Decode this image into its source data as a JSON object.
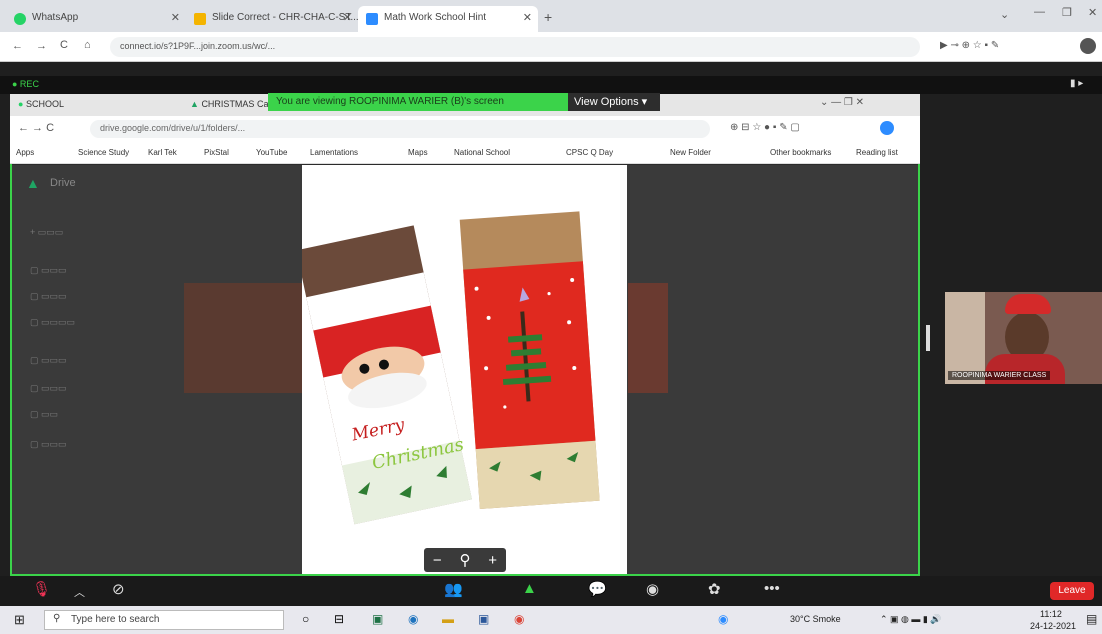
{
  "outer_browser": {
    "tabs": [
      {
        "label": "WhatsApp",
        "color": "#25d366"
      },
      {
        "label": "Slide Correct - CHR-CHA-C-ST..."
      },
      {
        "label": "Math Work School Hint"
      }
    ],
    "url": "connect.io/s?1P9F...join.zoom.us/wc/..."
  },
  "zoom": {
    "top_label": "● REC",
    "share_banner": "You are viewing ROOPINIMA WARIER (B)'s screen",
    "view_options": "View Options ▾",
    "participant_name": "ROOPINIMA WARIER CLASS",
    "toolbar": {
      "leave": "Leave"
    }
  },
  "shared_screen": {
    "inner_tabs": [
      {
        "label": "SCHOOL"
      },
      {
        "label": "CHRISTMAS Cards"
      }
    ],
    "inner_url": "drive.google.com/drive/u/1/folders/...",
    "bookmarks": [
      "Apps",
      "Science Study",
      "Karl Tek",
      "PixStal",
      "YouTube",
      "Lamentations",
      "Maps",
      "National School",
      "CPSC Q Day",
      "New Folder",
      "Other bookmarks",
      "Reading list"
    ],
    "drive_app": "Drive",
    "card_text_1": "Merry",
    "card_text_2": "Christmas"
  },
  "taskbar": {
    "search_placeholder": "Type here to search",
    "weather": "30°C Smoke",
    "time": "11:12",
    "date": "24-12-2021"
  },
  "colors": {
    "share_green": "#3bd34a",
    "leave_red": "#e02828"
  }
}
